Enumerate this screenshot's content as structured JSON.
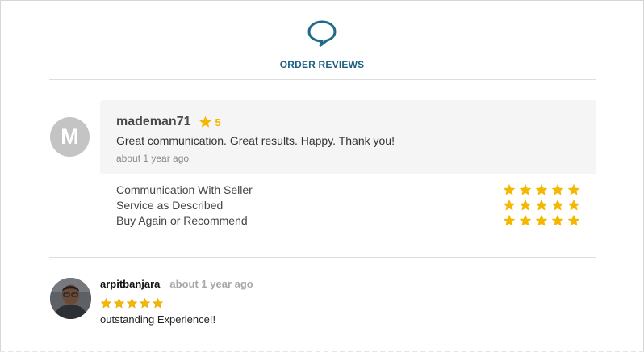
{
  "header": {
    "title": "ORDER REVIEWS",
    "icon": "chat-bubble-icon",
    "color": "#1e5f84"
  },
  "reviews": [
    {
      "avatar_letter": "M",
      "username": "mademan71",
      "rating": "5",
      "text": "Great communication. Great results. Happy. Thank you!",
      "time": "about 1 year ago",
      "breakdown": [
        {
          "label": "Communication With Seller",
          "stars": 5
        },
        {
          "label": "Service as Described",
          "stars": 5
        },
        {
          "label": "Buy Again or Recommend",
          "stars": 5
        }
      ]
    },
    {
      "username": "arpitbanjara",
      "time": "about 1 year ago",
      "stars": 5,
      "text": "outstanding Experience!!"
    }
  ],
  "colors": {
    "star": "#f5b800",
    "review_bg": "#f5f5f5",
    "avatar_bg": "#c4c4c4"
  }
}
